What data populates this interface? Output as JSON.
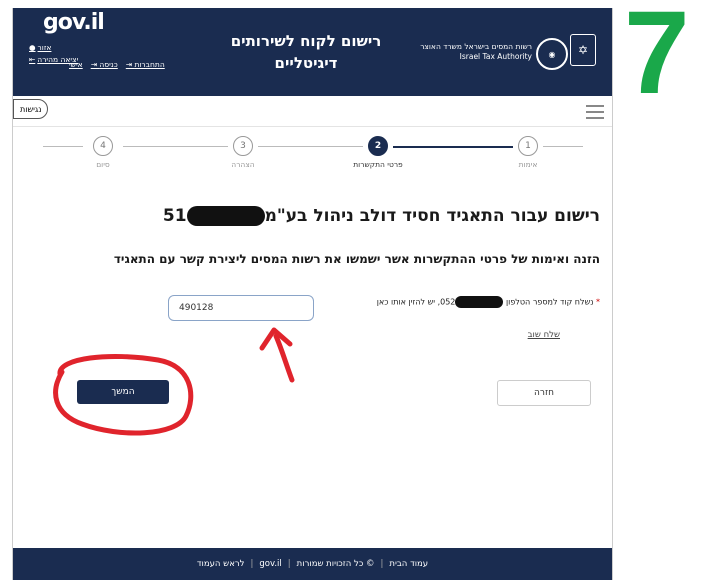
{
  "step_marker": "7",
  "header": {
    "logo": "gov.il",
    "link_login": "אזור",
    "link_personal": "אישי",
    "link_login2": "כניסה",
    "link_connect": "התחברות",
    "link_quickexit": "יציאה מהירה",
    "title_line1": "רישום לקוח לשירותים",
    "title_line2": "דיגיטליים",
    "ita_he": "רשות המסים בישראל משרד האוצר",
    "ita_en": "Israel Tax Authority"
  },
  "accessibility_label": "נגישות",
  "steps": [
    {
      "number": "1",
      "label": "אימות"
    },
    {
      "number": "2",
      "label": "פרטי התקשרות"
    },
    {
      "number": "3",
      "label": "הצהרה"
    },
    {
      "number": "4",
      "label": "סיום"
    }
  ],
  "active_step": 2,
  "title_prefix": "רישום עבור התאגיד חסיד דולב ניהול בע\"מ",
  "title_suffix": "51",
  "subtitle": "הזנה ואימות של פרטי ההתקשרות אשר ישמשו את רשות המסים ליצירת קשר עם התאגיד",
  "code_field": {
    "required_mark": "*",
    "label_start": "נשלח קוד למספר הטלפון",
    "label_phone": "052",
    "label_end": ", יש להזין אותו כאן",
    "value": "490128"
  },
  "resend_link": "שלח שוב",
  "back_button": "חזרה",
  "next_button": "המשך",
  "footer": {
    "home": "עמוד הבית",
    "rights": "© כל הזכויות שמורות",
    "logo": "gov.il",
    "top": "לראש העמוד"
  },
  "colors": {
    "header_bg": "#1a2c50",
    "marker_green": "#1aa84a",
    "annotation_red": "#e0242c"
  }
}
